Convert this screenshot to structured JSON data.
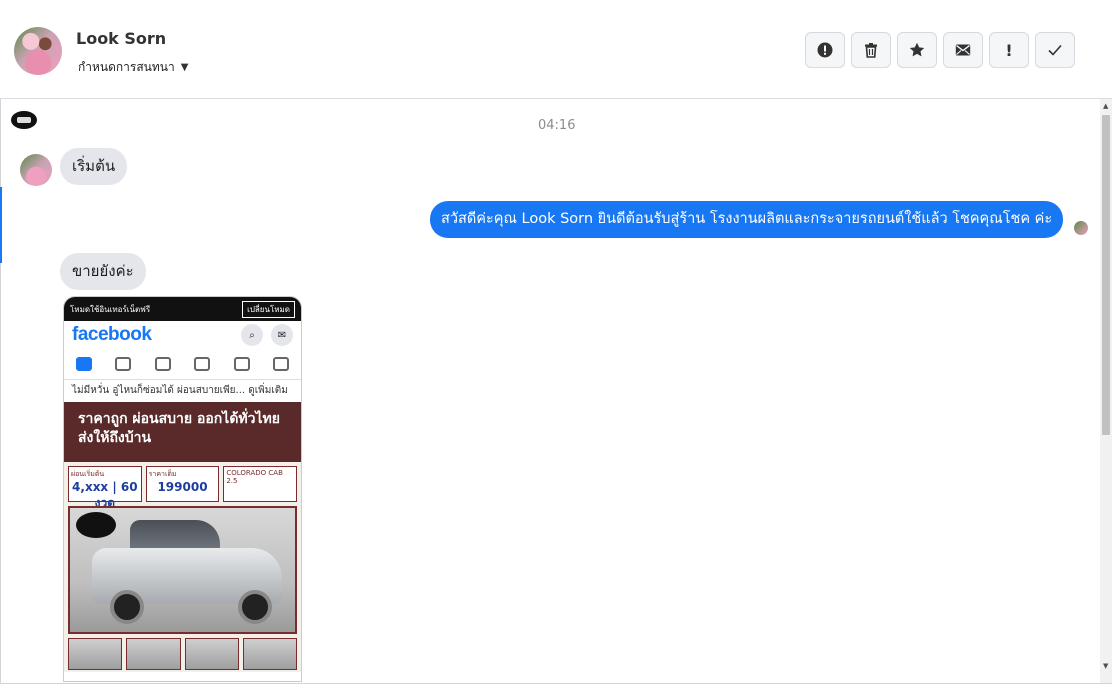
{
  "header": {
    "contact_name": "Look Sorn",
    "assign_label": "กำหนดการสนทนา",
    "toolbar": [
      {
        "name": "spam-button",
        "icon": "alert-circle-icon"
      },
      {
        "name": "delete-button",
        "icon": "trash-icon"
      },
      {
        "name": "star-button",
        "icon": "star-icon"
      },
      {
        "name": "mark-unread-button",
        "icon": "envelope-icon"
      },
      {
        "name": "follow-up-button",
        "label": "!"
      },
      {
        "name": "mark-done-button",
        "icon": "check-icon"
      }
    ]
  },
  "chat": {
    "timestamp": "04:16",
    "messages": [
      {
        "direction": "incoming",
        "text": "เริ่มต้น"
      },
      {
        "direction": "outgoing",
        "text": "สวัสดีค่ะคุณ Look Sorn ยินดีต้อนรับสู่ร้าน โรงงานผลิตและกระจายรถยนต์ใช้แล้ว โชคคุณโชค ค่ะ"
      },
      {
        "direction": "incoming",
        "text": "ขายยังค่ะ"
      }
    ],
    "attachment": {
      "top_bar_text": "โหมดใช้อินเทอร์เน็ตฟรี",
      "mode_button": "เปลี่ยนโหมด",
      "app_logo": "facebook",
      "caption": "ไม่มีหวั่น อู่ไหนก็ซ่อมได้ ผ่อนสบายเพีย... ดูเพิ่มเติม",
      "banner_line1": "ราคาถูก ผ่อนสบาย ออกได้ทั่วไทย",
      "banner_line2": "ส่งให้ถึงบ้าน",
      "ad_label_left": "ผ่อนเริ่มต้น",
      "ad_value_left": "4,xxx | 60 งวด",
      "ad_label_mid": "ราคาเต็ม",
      "ad_price": "199000",
      "ad_model": "COLORADO CAB 2.5"
    }
  },
  "colors": {
    "accent": "#1877f2",
    "incoming_bubble": "#e4e6eb",
    "banner": "#5a2a2a"
  }
}
